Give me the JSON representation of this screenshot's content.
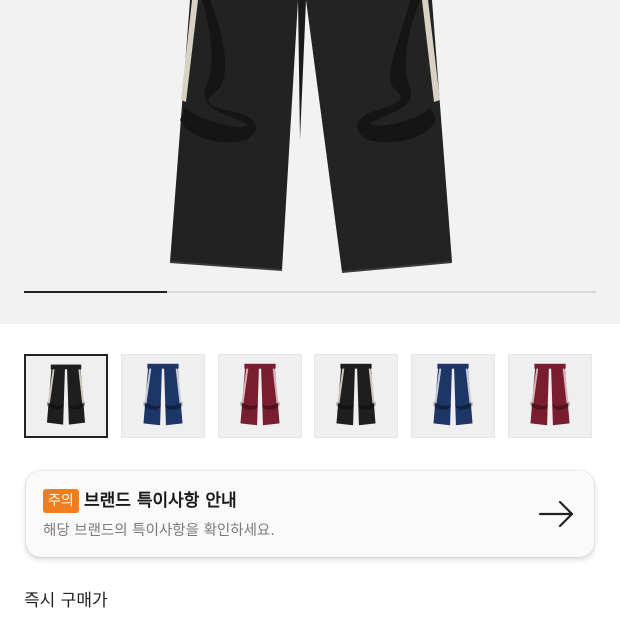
{
  "product_images": {
    "current_index": 1,
    "total": 4,
    "progress_fraction": 0.25
  },
  "thumbnails": [
    {
      "color": "#1e1e1e",
      "stripe": "#cfc8bd",
      "selected": true
    },
    {
      "color": "#1d3567",
      "stripe": "#c9cbd6",
      "selected": false
    },
    {
      "color": "#7a1d2e",
      "stripe": "#d6b5bb",
      "selected": false
    },
    {
      "color": "#1e1e1e",
      "stripe": "#cfc8bd",
      "selected": false
    },
    {
      "color": "#1d3567",
      "stripe": "#c9cbd6",
      "selected": false
    },
    {
      "color": "#7a1d2e",
      "stripe": "#d6b5bb",
      "selected": false
    }
  ],
  "notice": {
    "badge": "주의",
    "title": "브랜드 특이사항 안내",
    "description": "해당 브랜드의 특이사항을 확인하세요.",
    "arrow_icon": "arrow-right-icon",
    "badge_color": "#f07e1e"
  },
  "price_section": {
    "label": "즉시 구매가"
  }
}
